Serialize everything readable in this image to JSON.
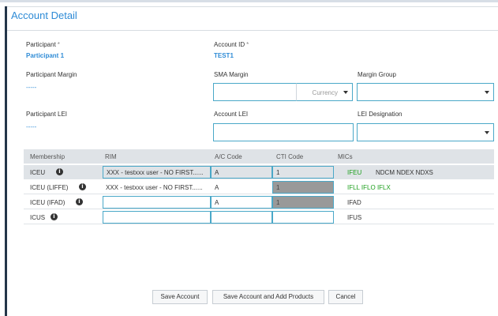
{
  "dialog": {
    "title": "Account Detail"
  },
  "form": {
    "participant_label": "Participant",
    "participant_value": "Participant 1",
    "account_id_label": "Account ID",
    "account_id_value": "TEST1",
    "required_mark": "*",
    "participant_margin_label": "Participant Margin",
    "participant_margin_value": "-----",
    "sma_margin_label": "SMA Margin",
    "sma_margin_value": "",
    "currency_placeholder": "Currency",
    "margin_group_label": "Margin Group",
    "margin_group_value": "",
    "participant_lei_label": "Participant LEI",
    "participant_lei_value": "-----",
    "account_lei_label": "Account LEI",
    "account_lei_value": "",
    "lei_designation_label": "LEI Designation",
    "lei_designation_value": ""
  },
  "table": {
    "headers": {
      "membership": "Membership",
      "rim": "RIM",
      "ac_code": "A/C Code",
      "cti_code": "CTI Code",
      "mics": "MICs"
    },
    "rows": [
      {
        "membership": "ICEU",
        "rim": "XXX - testxxx user - NO FIRST......",
        "ac_code": "A",
        "cti_code": "1",
        "mic_active": "IFEU",
        "mic_other": "NDCM NDEX NDXS"
      },
      {
        "membership": "ICEU (LIFFE)",
        "rim": "XXX - testxxx user - NO FIRST......",
        "ac_code": "A",
        "cti_code": "1",
        "mic_active": "IFLL IFLO IFLX",
        "mic_other": ""
      },
      {
        "membership": "ICEU (IFAD)",
        "rim": "",
        "ac_code": "A",
        "cti_code": "1",
        "mic_active": "",
        "mic_other": "IFAD"
      },
      {
        "membership": "ICUS",
        "rim": "",
        "ac_code": "",
        "cti_code": "",
        "mic_active": "",
        "mic_other": "IFUS"
      }
    ],
    "info_glyph": "i"
  },
  "buttons": {
    "save_account": "Save Account",
    "save_add_products": "Save Account and Add Products",
    "cancel": "Cancel"
  },
  "colors": {
    "accent": "#2e8bd6",
    "border": "#4aa8c8",
    "mic_active": "#1ea01e",
    "header_bg": "#dfe3e7"
  }
}
